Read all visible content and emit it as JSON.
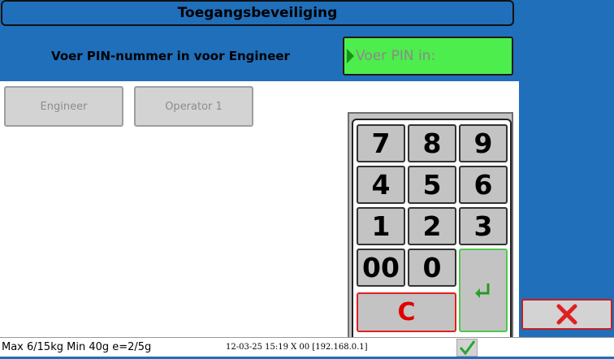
{
  "header": {
    "title": "Toegangsbeveiliging"
  },
  "prompt": {
    "text": "Voer PIN-nummer in voor Engineer"
  },
  "pin": {
    "placeholder": "Voer PIN in:",
    "value": ""
  },
  "users": [
    {
      "label": "Engineer",
      "enabled": false
    },
    {
      "label": "Operator 1",
      "enabled": false
    }
  ],
  "keypad": {
    "keys": [
      "7",
      "8",
      "9",
      "4",
      "5",
      "6",
      "1",
      "2",
      "3",
      "00",
      "0"
    ],
    "clear_label": "C",
    "enter_icon": "enter-arrow-icon"
  },
  "cancel": {
    "icon": "close-icon",
    "color": "#e02020"
  },
  "status": {
    "scale_info": "Max 6/15kg Min 40g e=2/5g",
    "datetime_info": "12-03-25 15:19 X 00 [192.168.0.1]",
    "indicator_icon": "check-icon"
  },
  "colors": {
    "background": "#1f6fbb",
    "pin_field": "#4ded4d",
    "key": "#c3c3c3",
    "accent_red": "#e00000",
    "accent_green": "#1b8f1b"
  }
}
